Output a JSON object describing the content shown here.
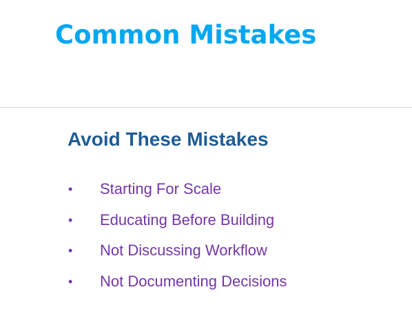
{
  "slide": {
    "title": "Common Mistakes",
    "section_heading": "Avoid These Mistakes",
    "bullet_glyph": "•",
    "bullets": [
      "Starting For Scale",
      "Educating Before Building",
      "Not Discussing Workflow",
      "Not Documenting Decisions"
    ]
  },
  "colors": {
    "title": "#00a7f2",
    "heading": "#1f5c94",
    "bullets": "#7436a6",
    "divider": "#d9d9d9"
  }
}
